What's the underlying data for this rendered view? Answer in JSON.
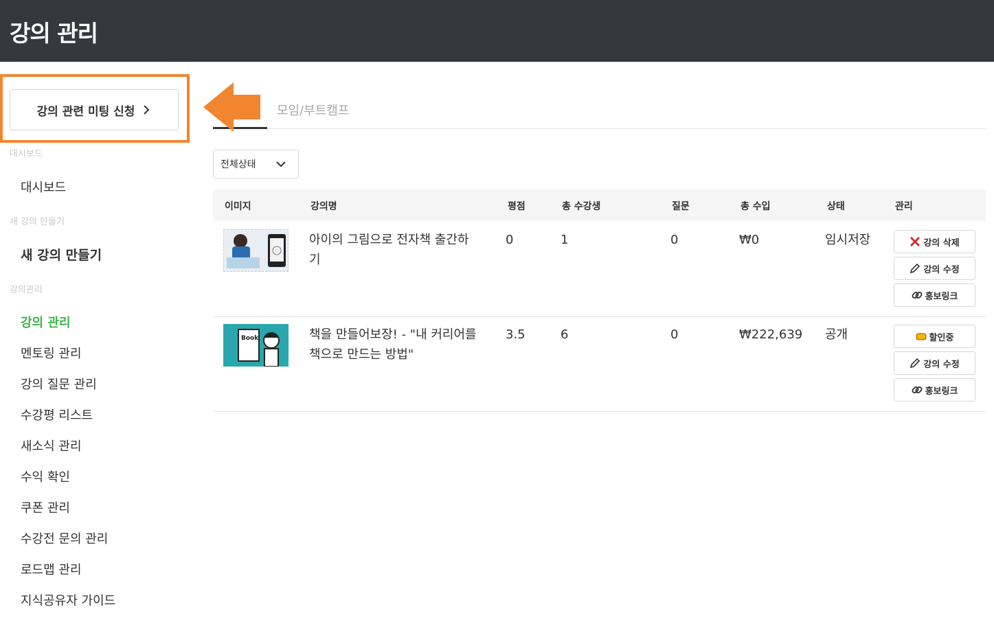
{
  "header": {
    "title": "강의 관리"
  },
  "sidebar": {
    "meeting_button": "강의 관련 미팅 신청",
    "sections": [
      {
        "label": "대시보드",
        "items": [
          {
            "label": "대시보드"
          }
        ]
      },
      {
        "label": "새 강의 만들기",
        "items": [
          {
            "label": "새 강의 만들기"
          }
        ]
      },
      {
        "label": "강의관리",
        "items": [
          {
            "label": "강의 관리",
            "active": true
          },
          {
            "label": "멘토링 관리"
          },
          {
            "label": "강의 질문 관리"
          },
          {
            "label": "수강평 리스트"
          },
          {
            "label": "새소식 관리"
          },
          {
            "label": "수익 확인"
          },
          {
            "label": "쿠폰 관리"
          },
          {
            "label": "수강전 문의 관리"
          },
          {
            "label": "로드맵 관리"
          },
          {
            "label": "지식공유자 가이드"
          }
        ]
      }
    ]
  },
  "tabs": [
    {
      "label": "",
      "active": true
    },
    {
      "label": "모임/부트캠프"
    }
  ],
  "filter": {
    "selected": "전체상태"
  },
  "table": {
    "columns": [
      "이미지",
      "강의명",
      "평점",
      "총 수강생",
      "질문",
      "총 수입",
      "상태",
      "관리"
    ],
    "rows": [
      {
        "title_line1": "아이의 그림으로 전자책 출간하",
        "title_line2": "기",
        "rating": "0",
        "students": "1",
        "questions": "0",
        "revenue": "₩0",
        "status": "임시저장",
        "actions": [
          "강의 삭제",
          "강의 수정",
          "홍보링크"
        ]
      },
      {
        "title_line1": "책을 만들어보장! - \"내 커리어를",
        "title_line2": "책으로 만드는 방법\"",
        "rating": "3.5",
        "students": "6",
        "questions": "0",
        "revenue": "₩222,639",
        "status": "공개",
        "actions": [
          "할인중",
          "강의 수정",
          "홍보링크"
        ]
      }
    ]
  },
  "thumb_text": "Book",
  "colors": {
    "header_bg": "#343a3c",
    "highlight": "#f2852f",
    "active": "#3db54a"
  },
  "icons": {
    "delete": "x-icon",
    "edit": "pencil-icon",
    "promo": "link-icon",
    "discount": "coupon-icon"
  }
}
